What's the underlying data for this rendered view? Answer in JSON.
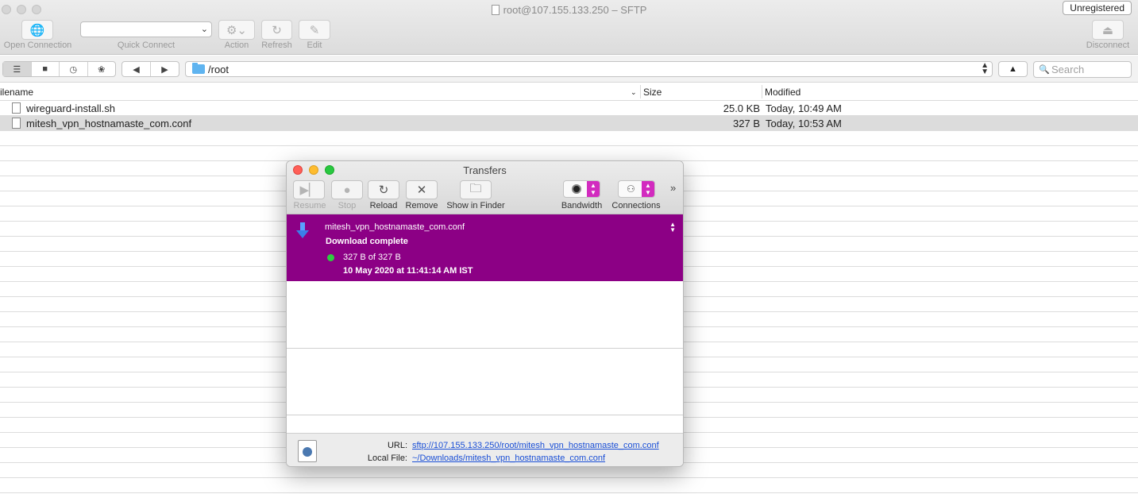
{
  "window": {
    "title": "root@107.155.133.250 – SFTP",
    "badge": "Unregistered"
  },
  "toolbar": {
    "open_connection": "Open Connection",
    "quick_connect": "Quick Connect",
    "action": "Action",
    "refresh": "Refresh",
    "edit": "Edit",
    "disconnect": "Disconnect"
  },
  "pathbar": {
    "path": "/root",
    "search_placeholder": "Search"
  },
  "columns": {
    "filename": "ilename",
    "size": "Size",
    "modified": "Modified"
  },
  "files": [
    {
      "name": "wireguard-install.sh",
      "size": "25.0 KB",
      "modified": "Today, 10:49 AM"
    },
    {
      "name": "mitesh_vpn_hostnamaste_com.conf",
      "size": "327 B",
      "modified": "Today, 10:53 AM"
    }
  ],
  "transfers": {
    "title": "Transfers",
    "buttons": {
      "resume": "Resume",
      "stop": "Stop",
      "reload": "Reload",
      "remove": "Remove",
      "show_in_finder": "Show in Finder",
      "bandwidth": "Bandwidth",
      "connections": "Connections"
    },
    "item": {
      "name": "mitesh_vpn_hostnamaste_com.conf",
      "status": "Download complete",
      "progress": "327 B of 327 B",
      "date": "10 May 2020 at 11:41:14 AM IST"
    },
    "footer": {
      "url_label": "URL:",
      "url": "sftp://107.155.133.250/root/mitesh_vpn_hostnamaste_com.conf",
      "local_label": "Local File:",
      "local": "~/Downloads/mitesh_vpn_hostnamaste_com.conf"
    }
  },
  "colors": {
    "selection": "#8c0085",
    "accent": "#d22bbf",
    "link": "#1a4fd6",
    "status_dot": "#2ecc40"
  }
}
